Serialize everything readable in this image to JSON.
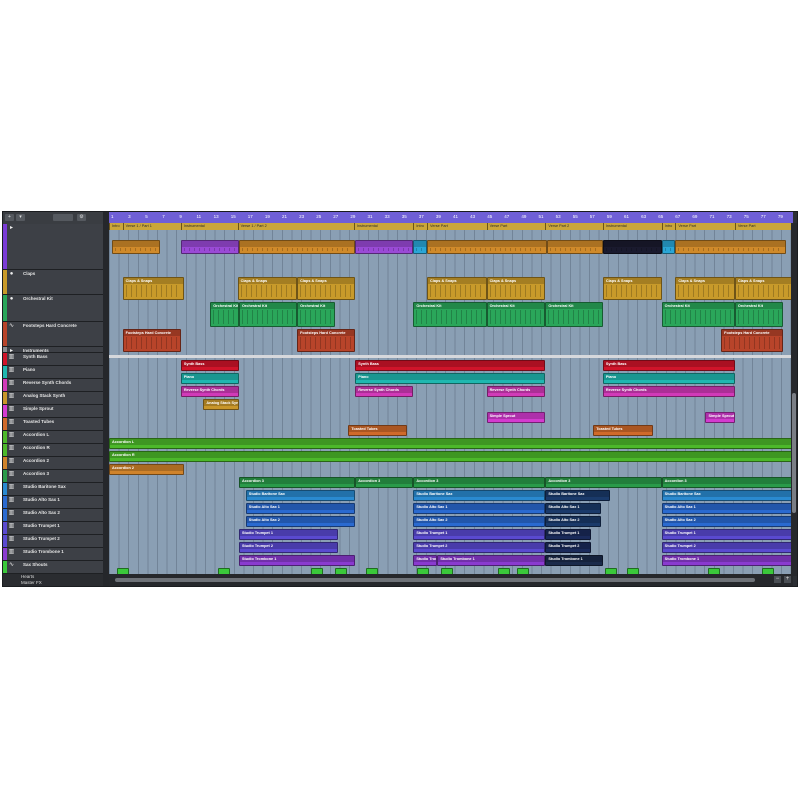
{
  "ruler": {
    "ticks": [
      "1",
      "3",
      "5",
      "7",
      "9",
      "11",
      "13",
      "15",
      "17",
      "19",
      "21",
      "23",
      "25",
      "27",
      "29",
      "31",
      "33",
      "35",
      "37",
      "39",
      "41",
      "43",
      "45",
      "47",
      "49",
      "51",
      "53",
      "55",
      "57",
      "59",
      "61",
      "63",
      "65",
      "67",
      "69",
      "71",
      "73",
      "75",
      "77",
      "79"
    ]
  },
  "markers": [
    {
      "label": "Intro",
      "start": 0.0,
      "end": 0.02
    },
    {
      "label": "Verse 1 / Part 1",
      "start": 0.02,
      "end": 0.105
    },
    {
      "label": "Instrumental",
      "start": 0.105,
      "end": 0.188
    },
    {
      "label": "Verse 1 / Part 2",
      "start": 0.188,
      "end": 0.358
    },
    {
      "label": "Instrumental",
      "start": 0.358,
      "end": 0.445
    },
    {
      "label": "Intro",
      "start": 0.445,
      "end": 0.465
    },
    {
      "label": "Verse Part",
      "start": 0.465,
      "end": 0.552
    },
    {
      "label": "Verse Part",
      "start": 0.552,
      "end": 0.638
    },
    {
      "label": "Verse Part 2",
      "start": 0.638,
      "end": 0.722
    },
    {
      "label": "Instrumental",
      "start": 0.722,
      "end": 0.808
    },
    {
      "label": "Intro",
      "start": 0.808,
      "end": 0.828
    },
    {
      "label": "Verse Part",
      "start": 0.828,
      "end": 0.915
    },
    {
      "label": "Verse Part",
      "start": 0.915,
      "end": 1.0
    }
  ],
  "footer": {
    "label1": "Hearts",
    "label2": "Master FX"
  },
  "tracks": [
    {
      "name": "",
      "color": "#7a3bd6",
      "icon": "folder-icon",
      "h": 46,
      "mute": false
    },
    {
      "name": "Claps",
      "color": "#c89a2a",
      "icon": "drum-icon",
      "h": 25,
      "mute": false
    },
    {
      "name": "Orchestral Kit",
      "color": "#2aa65a",
      "icon": "drum-icon",
      "h": 27,
      "mute": false
    },
    {
      "name": "Footsteps Hard Concrete",
      "color": "#b8442a",
      "icon": "audio-icon",
      "h": 25,
      "mute": false
    },
    {
      "name": "Instruments",
      "color": "#8a8d92",
      "icon": "folder-icon",
      "h": 6,
      "mute": false
    },
    {
      "name": "Synth Bass",
      "color": "#d0142a",
      "icon": "keys-icon",
      "h": 13,
      "mute": true
    },
    {
      "name": "Piano",
      "color": "#1fb8b0",
      "icon": "keys-icon",
      "h": 13,
      "mute": true
    },
    {
      "name": "Reverse Synth Chords",
      "color": "#d13ab8",
      "icon": "keys-icon",
      "h": 13,
      "mute": false
    },
    {
      "name": "Analog Stack Synth",
      "color": "#c8962a",
      "icon": "keys-icon",
      "h": 13,
      "mute": false
    },
    {
      "name": "Simple Sprout",
      "color": "#d43bd0",
      "icon": "keys-icon",
      "h": 13,
      "mute": false
    },
    {
      "name": "Toasted Tubes",
      "color": "#d06a2a",
      "icon": "keys-icon",
      "h": 13,
      "mute": false
    },
    {
      "name": "Accordion L",
      "color": "#4cb82a",
      "icon": "keys-icon",
      "h": 13,
      "mute": true
    },
    {
      "name": "Accordion R",
      "color": "#4cb82a",
      "icon": "keys-icon",
      "h": 13,
      "mute": true
    },
    {
      "name": "Accordion 2",
      "color": "#d0832a",
      "icon": "keys-icon",
      "h": 13,
      "mute": false
    },
    {
      "name": "Accordion 3",
      "color": "#2a9a4a",
      "icon": "keys-icon",
      "h": 13,
      "mute": true
    },
    {
      "name": "Studio Baritone Sax",
      "color": "#2a8ad0",
      "icon": "keys-icon",
      "h": 13,
      "mute": true
    },
    {
      "name": "Studio Alto Sax 1",
      "color": "#2a6ad0",
      "icon": "keys-icon",
      "h": 13,
      "mute": true
    },
    {
      "name": "Studio Alto Sax 2",
      "color": "#2a6ad0",
      "icon": "keys-icon",
      "h": 13,
      "mute": true
    },
    {
      "name": "Studio Trumpet 1",
      "color": "#5a4ad0",
      "icon": "keys-icon",
      "h": 13,
      "mute": true
    },
    {
      "name": "Studio Trumpet 2",
      "color": "#5a4ad0",
      "icon": "keys-icon",
      "h": 13,
      "mute": true
    },
    {
      "name": "Studio Trombone 1",
      "color": "#8a3ad0",
      "icon": "keys-icon",
      "h": 13,
      "mute": true
    },
    {
      "name": "Sax Shouts",
      "color": "#3ac83a",
      "icon": "audio-icon",
      "h": 13,
      "mute": true
    }
  ],
  "parts": [
    {
      "label": "",
      "track": 0,
      "start": 0.005,
      "end": 0.075,
      "color": "#d08a2a",
      "row": 0
    },
    {
      "label": "",
      "track": 0,
      "start": 0.105,
      "end": 0.19,
      "color": "#9a4ad6",
      "row": 0
    },
    {
      "label": "",
      "track": 0,
      "start": 0.19,
      "end": 0.36,
      "color": "#d08a2a",
      "row": 0
    },
    {
      "label": "",
      "track": 0,
      "start": 0.36,
      "end": 0.445,
      "color": "#9a4ad6",
      "row": 0
    },
    {
      "label": "",
      "track": 0,
      "start": 0.445,
      "end": 0.465,
      "color": "#2aa6d6",
      "row": 0
    },
    {
      "label": "",
      "track": 0,
      "start": 0.465,
      "end": 0.64,
      "color": "#d08a2a",
      "row": 0
    },
    {
      "label": "",
      "track": 0,
      "start": 0.64,
      "end": 0.722,
      "color": "#d08a2a",
      "row": 0
    },
    {
      "label": "",
      "track": 0,
      "start": 0.722,
      "end": 0.808,
      "color": "#1a1a2e",
      "row": 0
    },
    {
      "label": "",
      "track": 0,
      "start": 0.808,
      "end": 0.828,
      "color": "#2aa6d6",
      "row": 0
    },
    {
      "label": "",
      "track": 0,
      "start": 0.828,
      "end": 0.99,
      "color": "#d08a2a",
      "row": 0
    },
    {
      "label": "Claps & Snaps",
      "track": 1,
      "start": 0.02,
      "end": 0.11,
      "color": "#c89a2a"
    },
    {
      "label": "Claps & Snaps",
      "track": 1,
      "start": 0.188,
      "end": 0.275,
      "color": "#c89a2a"
    },
    {
      "label": "Claps & Snaps",
      "track": 1,
      "start": 0.275,
      "end": 0.36,
      "color": "#c89a2a"
    },
    {
      "label": "Claps & Snaps",
      "track": 1,
      "start": 0.465,
      "end": 0.552,
      "color": "#c89a2a"
    },
    {
      "label": "Claps & Snaps",
      "track": 1,
      "start": 0.552,
      "end": 0.638,
      "color": "#c89a2a"
    },
    {
      "label": "Claps & Snaps",
      "track": 1,
      "start": 0.722,
      "end": 0.808,
      "color": "#c89a2a"
    },
    {
      "label": "Claps & Snaps",
      "track": 1,
      "start": 0.828,
      "end": 0.915,
      "color": "#c89a2a"
    },
    {
      "label": "Claps & Snaps",
      "track": 1,
      "start": 0.915,
      "end": 1.0,
      "color": "#c89a2a"
    },
    {
      "label": "Orchestral Kit",
      "track": 2,
      "start": 0.148,
      "end": 0.19,
      "color": "#2aa65a"
    },
    {
      "label": "Orchestral Kit",
      "track": 2,
      "start": 0.19,
      "end": 0.275,
      "color": "#2aa65a"
    },
    {
      "label": "Orchestral Kit",
      "track": 2,
      "start": 0.275,
      "end": 0.33,
      "color": "#2aa65a"
    },
    {
      "label": "Orchestral Kit",
      "track": 2,
      "start": 0.445,
      "end": 0.552,
      "color": "#2aa65a"
    },
    {
      "label": "Orchestral Kit",
      "track": 2,
      "start": 0.552,
      "end": 0.638,
      "color": "#2aa65a"
    },
    {
      "label": "Orchestral Kit",
      "track": 2,
      "start": 0.638,
      "end": 0.722,
      "color": "#2aa65a"
    },
    {
      "label": "Orchestral Kit",
      "track": 2,
      "start": 0.808,
      "end": 0.915,
      "color": "#2aa65a"
    },
    {
      "label": "Orchestral Kit",
      "track": 2,
      "start": 0.915,
      "end": 0.985,
      "color": "#2aa65a"
    },
    {
      "label": "Footsteps Hard Concrete",
      "track": 3,
      "start": 0.02,
      "end": 0.105,
      "color": "#b8442a"
    },
    {
      "label": "Footsteps Hard Concrete",
      "track": 3,
      "start": 0.275,
      "end": 0.36,
      "color": "#b8442a"
    },
    {
      "label": "Footsteps Hard Concrete",
      "track": 3,
      "start": 0.895,
      "end": 0.985,
      "color": "#b8442a"
    },
    {
      "label": "Synth Bass",
      "track": 5,
      "start": 0.105,
      "end": 0.19,
      "color": "#d0142a"
    },
    {
      "label": "Synth Bass",
      "track": 5,
      "start": 0.36,
      "end": 0.638,
      "color": "#d0142a"
    },
    {
      "label": "Synth Bass",
      "track": 5,
      "start": 0.722,
      "end": 0.915,
      "color": "#d0142a"
    },
    {
      "label": "Piano",
      "track": 6,
      "start": 0.105,
      "end": 0.19,
      "color": "#1fb8b0"
    },
    {
      "label": "Piano",
      "track": 6,
      "start": 0.36,
      "end": 0.638,
      "color": "#1fb8b0"
    },
    {
      "label": "Piano",
      "track": 6,
      "start": 0.722,
      "end": 0.915,
      "color": "#1fb8b0"
    },
    {
      "label": "Reverse Synth Chords",
      "track": 7,
      "start": 0.105,
      "end": 0.19,
      "color": "#d13ab8"
    },
    {
      "label": "Reverse Synth Chords",
      "track": 7,
      "start": 0.36,
      "end": 0.445,
      "color": "#d13ab8"
    },
    {
      "label": "Reverse Synth Chords",
      "track": 7,
      "start": 0.552,
      "end": 0.638,
      "color": "#d13ab8"
    },
    {
      "label": "Reverse Synth Chords",
      "track": 7,
      "start": 0.722,
      "end": 0.915,
      "color": "#d13ab8"
    },
    {
      "label": "Analog Stack Synth",
      "track": 8,
      "start": 0.138,
      "end": 0.19,
      "color": "#c8962a"
    },
    {
      "label": "Simple Sprout",
      "track": 9,
      "start": 0.552,
      "end": 0.638,
      "color": "#d43bd0"
    },
    {
      "label": "Simple Sprout",
      "track": 9,
      "start": 0.872,
      "end": 0.915,
      "color": "#d43bd0"
    },
    {
      "label": "Toasted Tubes",
      "track": 10,
      "start": 0.35,
      "end": 0.435,
      "color": "#d06a2a"
    },
    {
      "label": "Toasted Tubes",
      "track": 10,
      "start": 0.708,
      "end": 0.795,
      "color": "#d06a2a"
    },
    {
      "label": "Accordion L",
      "track": 11,
      "start": 0.0,
      "end": 1.0,
      "color": "#4cb82a"
    },
    {
      "label": "Accordion R",
      "track": 12,
      "start": 0.0,
      "end": 1.0,
      "color": "#4cb82a"
    },
    {
      "label": "Accordion 2",
      "track": 13,
      "start": 0.0,
      "end": 0.11,
      "color": "#d0832a"
    },
    {
      "label": "Accordion 3",
      "track": 14,
      "start": 0.19,
      "end": 0.36,
      "color": "#2a9a4a"
    },
    {
      "label": "Accordion 3",
      "track": 14,
      "start": 0.36,
      "end": 0.445,
      "color": "#2a9a4a"
    },
    {
      "label": "Accordion 3",
      "track": 14,
      "start": 0.445,
      "end": 0.638,
      "color": "#2a9a4a"
    },
    {
      "label": "Accordion 3",
      "track": 14,
      "start": 0.638,
      "end": 0.808,
      "color": "#2a9a4a"
    },
    {
      "label": "Accordion 3",
      "track": 14,
      "start": 0.808,
      "end": 1.0,
      "color": "#2a9a4a"
    },
    {
      "label": "Studio Baritone Sax",
      "track": 15,
      "start": 0.2,
      "end": 0.36,
      "color": "#2a8ad0"
    },
    {
      "label": "Studio Baritone Sax",
      "track": 15,
      "start": 0.445,
      "end": 0.638,
      "color": "#2a8ad0"
    },
    {
      "label": "Studio Baritone Sax",
      "track": 15,
      "start": 0.638,
      "end": 0.733,
      "color": "#1a3a6a"
    },
    {
      "label": "Studio Baritone Sax",
      "track": 15,
      "start": 0.808,
      "end": 1.0,
      "color": "#2a8ad0"
    },
    {
      "label": "Studio Alto Sax 1",
      "track": 16,
      "start": 0.2,
      "end": 0.36,
      "color": "#2a6ad0"
    },
    {
      "label": "Studio Alto Sax 1",
      "track": 16,
      "start": 0.445,
      "end": 0.638,
      "color": "#2a6ad0"
    },
    {
      "label": "Studio Alto Sax 1",
      "track": 16,
      "start": 0.638,
      "end": 0.72,
      "color": "#1a3a6a"
    },
    {
      "label": "Studio Alto Sax 1",
      "track": 16,
      "start": 0.808,
      "end": 1.0,
      "color": "#2a6ad0"
    },
    {
      "label": "Studio Alto Sax 2",
      "track": 17,
      "start": 0.2,
      "end": 0.36,
      "color": "#2a6ad0"
    },
    {
      "label": "Studio Alto Sax 2",
      "track": 17,
      "start": 0.445,
      "end": 0.638,
      "color": "#2a6ad0"
    },
    {
      "label": "Studio Alto Sax 2",
      "track": 17,
      "start": 0.638,
      "end": 0.72,
      "color": "#1a3a6a"
    },
    {
      "label": "Studio Alto Sax 2",
      "track": 17,
      "start": 0.808,
      "end": 1.0,
      "color": "#2a6ad0"
    },
    {
      "label": "Studio Trumpet 1",
      "track": 18,
      "start": 0.19,
      "end": 0.335,
      "color": "#5a4ad0"
    },
    {
      "label": "Studio Trumpet 1",
      "track": 18,
      "start": 0.445,
      "end": 0.638,
      "color": "#5a4ad0"
    },
    {
      "label": "Studio Trumpet 1",
      "track": 18,
      "start": 0.638,
      "end": 0.705,
      "color": "#1a2a5a"
    },
    {
      "label": "Studio Trumpet 1",
      "track": 18,
      "start": 0.808,
      "end": 1.0,
      "color": "#5a4ad0"
    },
    {
      "label": "Studio Trumpet 2",
      "track": 19,
      "start": 0.19,
      "end": 0.335,
      "color": "#5a4ad0"
    },
    {
      "label": "Studio Trumpet 2",
      "track": 19,
      "start": 0.445,
      "end": 0.638,
      "color": "#5a4ad0"
    },
    {
      "label": "Studio Trumpet 2",
      "track": 19,
      "start": 0.638,
      "end": 0.705,
      "color": "#1a2a5a"
    },
    {
      "label": "Studio Trumpet 2",
      "track": 19,
      "start": 0.808,
      "end": 1.0,
      "color": "#5a4ad0"
    },
    {
      "label": "Studio Trombone 1",
      "track": 20,
      "start": 0.19,
      "end": 0.36,
      "color": "#8a3ad0"
    },
    {
      "label": "Studio Trombone 1",
      "track": 20,
      "start": 0.445,
      "end": 0.48,
      "color": "#8a3ad0"
    },
    {
      "label": "Studio Trombone 1",
      "track": 20,
      "start": 0.48,
      "end": 0.638,
      "color": "#8a3ad0"
    },
    {
      "label": "Studio Trombone 1",
      "track": 20,
      "start": 0.638,
      "end": 0.722,
      "color": "#1a2a4a"
    },
    {
      "label": "Studio Trombone 1",
      "track": 20,
      "start": 0.808,
      "end": 1.0,
      "color": "#8a3ad0"
    }
  ],
  "shouts": [
    0.012,
    0.16,
    0.295,
    0.33,
    0.375,
    0.45,
    0.485,
    0.568,
    0.596,
    0.725,
    0.758,
    0.875,
    0.955
  ]
}
